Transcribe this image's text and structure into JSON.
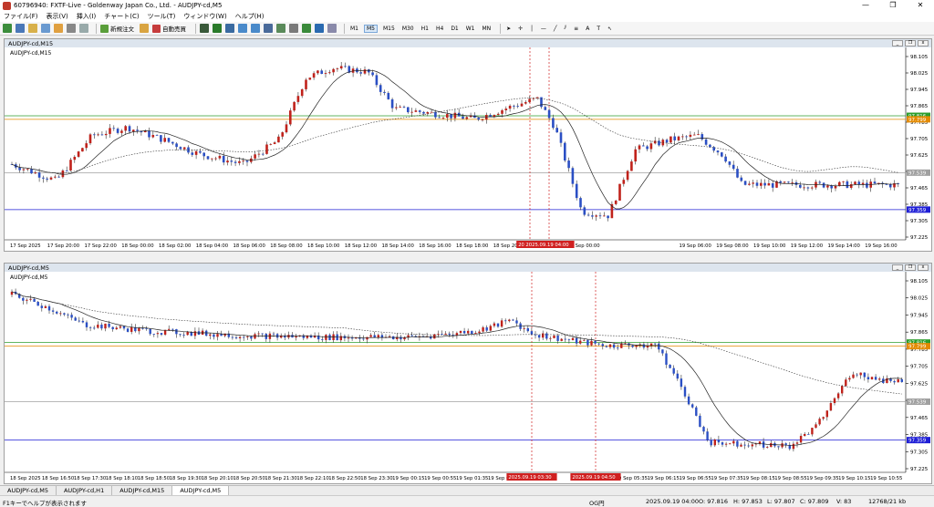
{
  "window": {
    "title": "60796940: FXTF-Live - Goldenway Japan Co., Ltd. - AUDJPY-cd,M5"
  },
  "menu": [
    "ファイル(F)",
    "表示(V)",
    "挿入(I)",
    "チャート(C)",
    "ツール(T)",
    "ウィンドウ(W)",
    "ヘルプ(H)"
  ],
  "toolbar": {
    "new_order": "新規注文",
    "auto_trade": "自動売買",
    "timeframes": [
      "M1",
      "M5",
      "M15",
      "M30",
      "H1",
      "H4",
      "D1",
      "W1",
      "MN"
    ],
    "active_timeframe": "M5"
  },
  "colors": {
    "bull": "#c0221b",
    "bear": "#2b4fc4",
    "green_line": "#2d9e2d",
    "orange_line": "#e38a00",
    "blue_line": "#1f1fd6",
    "gray_line": "#a0a0a0"
  },
  "chart_top": {
    "window_label": "AUDJPY-cd,M15",
    "chart_label": "AUDJPY-cd,M15",
    "y_ticks": [
      "98.105",
      "98.025",
      "97.945",
      "97.865",
      "97.785",
      "97.705",
      "97.625",
      "97.545",
      "97.465",
      "97.385",
      "97.305",
      "97.225"
    ],
    "hline_labels": {
      "green": "97.816",
      "orange": "97.799",
      "gray": "97.539",
      "blue": "97.359"
    },
    "x_labels": [
      "17 Sep 2025",
      "17 Sep 20:00",
      "17 Sep 22:00",
      "18 Sep 00:00",
      "18 Sep 02:00",
      "18 Sep 04:00",
      "18 Sep 06:00",
      "18 Sep 08:00",
      "18 Sep 10:00",
      "18 Sep 12:00",
      "18 Sep 14:00",
      "18 Sep 16:00",
      "18 Sep 18:00",
      "18 Sep 20:00",
      "18 Sep 22:00",
      "19 Sep 00:00",
      "",
      "",
      "19 Sep 06:00",
      "19 Sep 08:00",
      "19 Sep 10:00",
      "19 Sep 12:00",
      "19 Sep 14:00",
      "19 Sep 16:00"
    ],
    "time_markers": [
      "2025.09.",
      "2025.09.19 04:00"
    ]
  },
  "chart_bottom": {
    "window_label": "AUDJPY-cd,M5",
    "chart_label": "AUDJPY-cd,M5",
    "y_ticks": [
      "98.105",
      "98.025",
      "97.945",
      "97.865",
      "97.785",
      "97.705",
      "97.625",
      "97.545",
      "97.465",
      "97.385",
      "97.305",
      "97.225"
    ],
    "hline_labels": {
      "green": "97.816",
      "orange": "97.799",
      "gray": "97.539",
      "blue": "97.359"
    },
    "x_labels": [
      "18 Sep 2025",
      "18 Sep 16:50",
      "18 Sep 17:30",
      "18 Sep 18:10",
      "18 Sep 18:50",
      "18 Sep 19:30",
      "18 Sep 20:10",
      "18 Sep 20:50",
      "18 Sep 21:30",
      "18 Sep 22:10",
      "18 Sep 22:50",
      "18 Sep 23:30",
      "19 Sep 00:15",
      "19 Sep 00:55",
      "19 Sep 01:35",
      "19 Sep 02:15",
      "",
      "",
      "19 Sep 04:55",
      "19 Sep 05:35",
      "19 Sep 06:15",
      "19 Sep 06:55",
      "19 Sep 07:35",
      "19 Sep 08:15",
      "19 Sep 08:55",
      "19 Sep 09:35",
      "19 Sep 10:15",
      "19 Sep 10:55"
    ],
    "time_markers": [
      "2025.09.19 03:30",
      "2025.09.19 04:50"
    ]
  },
  "tabs": [
    "AUDJPY-cd,M5",
    "AUDJPY-cd,H1",
    "AUDJPY-cd,M15",
    "AUDJPY-cd,M5"
  ],
  "active_tab": 3,
  "status": {
    "help": "F1キーでヘルプが表示されます",
    "profile": "OG円",
    "datetime": "2025.09.19 04:00",
    "open": "O: 97.816",
    "high": "H: 97.853",
    "low": "L: 97.807",
    "close": "C: 97.809",
    "volume": "V: 83",
    "traffic": "12768/21 kb"
  }
}
